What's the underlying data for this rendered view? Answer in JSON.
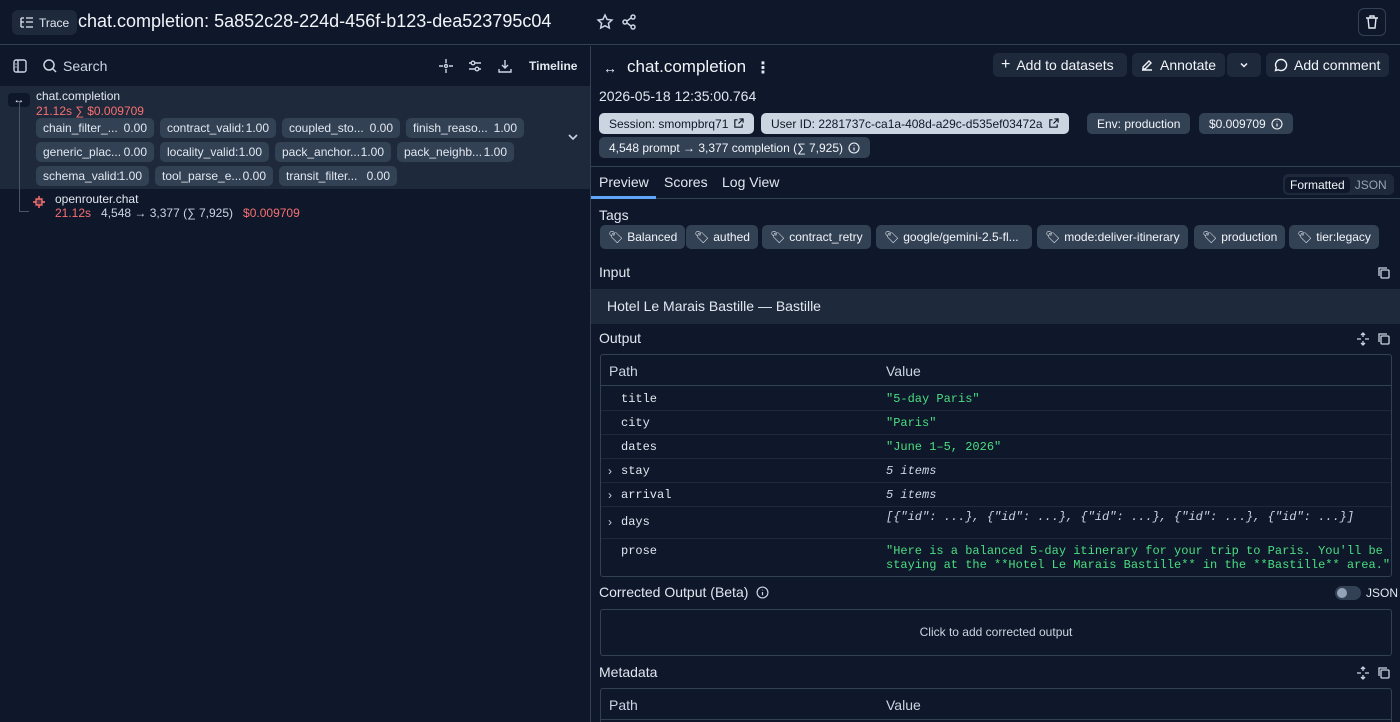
{
  "header": {
    "trace_label": "Trace",
    "title": "chat.completion: 5a852c28-224d-456f-b123-dea523795c04"
  },
  "left": {
    "search_placeholder": "Search",
    "timeline_label": "Timeline",
    "root": {
      "name": "chat.completion",
      "meta": "21.12s  ∑ $0.009709",
      "scores": [
        {
          "name": "chain_filter_...",
          "value": "0.00"
        },
        {
          "name": "contract_valid:",
          "value": "1.00"
        },
        {
          "name": "coupled_sto...",
          "value": "0.00"
        },
        {
          "name": "finish_reaso...",
          "value": "1.00"
        },
        {
          "name": "generic_plac...",
          "value": "0.00"
        },
        {
          "name": "locality_valid:",
          "value": "1.00"
        },
        {
          "name": "pack_anchor...",
          "value": "1.00"
        },
        {
          "name": "pack_neighb...",
          "value": "1.00"
        },
        {
          "name": "schema_valid:",
          "value": "1.00"
        },
        {
          "name": "tool_parse_e...",
          "value": "0.00"
        },
        {
          "name": "transit_filter...",
          "value": "0.00"
        }
      ]
    },
    "child": {
      "name": "openrouter.chat",
      "duration": "21.12s",
      "tokens": "4,548 → 3,377 (∑ 7,925)",
      "cost": "$0.009709"
    }
  },
  "right": {
    "title": "chat.completion",
    "add_datasets": "Add to datasets",
    "annotate": "Annotate",
    "add_comment": "Add comment",
    "timestamp": "2026-05-18 12:35:00.764",
    "badges": {
      "session": "Session: smompbrq71",
      "user": "User ID: 2281737c-ca1a-408d-a29c-d535ef03472a",
      "env": "Env: production",
      "cost": "$0.009709",
      "tokens": "4,548 prompt → 3,377 completion (∑ 7,925)"
    },
    "tabs": [
      "Preview",
      "Scores",
      "Log View"
    ],
    "view_modes": [
      "Formatted",
      "JSON"
    ],
    "tags_label": "Tags",
    "tags": [
      "Balanced",
      "authed",
      "contract_retry",
      "google/gemini-2.5-fl...",
      "mode:deliver-itinerary",
      "production",
      "tier:legacy"
    ],
    "input_label": "Input",
    "input_text": "Hotel Le Marais Bastille — Bastille",
    "output_label": "Output",
    "table_headers": [
      "Path",
      "Value"
    ],
    "output_rows": [
      {
        "key": "title",
        "value": "\"5-day Paris\""
      },
      {
        "key": "city",
        "value": "\"Paris\""
      },
      {
        "key": "dates",
        "value": "\"June 1–5, 2026\""
      },
      {
        "key": "stay",
        "value": "5 items"
      },
      {
        "key": "arrival",
        "value": "5 items"
      },
      {
        "key": "days",
        "value": "[{\"id\": ...}, {\"id\": ...}, {\"id\": ...}, {\"id\": ...}, {\"id\": ...}]"
      },
      {
        "key": "prose",
        "value": "\"Here is a balanced 5-day itinerary for your trip to Paris. You'll be\nstaying at the **Hotel Le Marais Bastille** in the **Bastille** area.\""
      }
    ],
    "corrected_label": "Corrected Output (Beta)",
    "json_toggle_label": "JSON",
    "corrected_placeholder": "Click to add corrected output",
    "metadata_label": "Metadata"
  },
  "colors": {
    "background": "#0f172a",
    "panel": "#1e293b",
    "accent": "#60a5fa",
    "cost_red": "#f87171",
    "string_green": "#4ade80"
  }
}
